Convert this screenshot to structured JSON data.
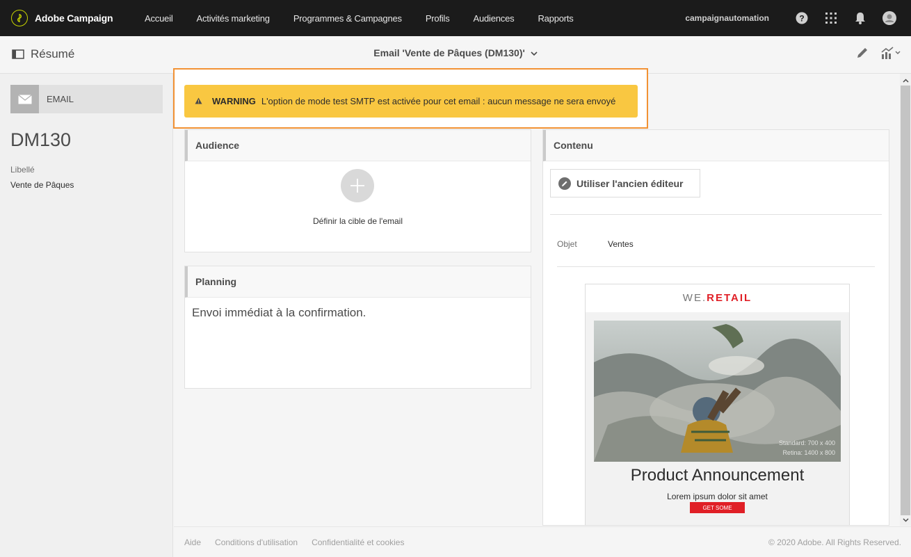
{
  "app": {
    "name": "Adobe Campaign",
    "user": "campaignautomation",
    "nav": [
      "Accueil",
      "Activités marketing",
      "Programmes & Campagnes",
      "Profils",
      "Audiences",
      "Rapports"
    ]
  },
  "subheader": {
    "summary_label": "Résumé",
    "title": "Email 'Vente de Pâques (DM130)'"
  },
  "left": {
    "channel_label": "EMAIL",
    "id": "DM130",
    "field_label": "Libellé",
    "field_value": "Vente de Pâques"
  },
  "warning": {
    "label": "WARNING",
    "message": "L'option de mode test SMTP est activée pour cet email : aucun message ne sera envoyé"
  },
  "audience": {
    "title": "Audience",
    "action": "Définir la cible de l'email"
  },
  "planning": {
    "title": "Planning",
    "text": "Envoi immédiat à la confirmation."
  },
  "contenu": {
    "title": "Contenu",
    "old_editor": "Utiliser l'ancien éditeur",
    "object_label": "Objet",
    "object_value": "Ventes",
    "preview": {
      "brand_a": "WE.",
      "brand_b": "RETAIL",
      "caption_1": "Standard: 700 x 400",
      "caption_2": "Retina: 1400 x 800",
      "title": "Product Announcement",
      "subtitle": "Lorem ipsum dolor sit amet",
      "button": "GET SOME"
    }
  },
  "footer": {
    "links": [
      "Aide",
      "Conditions d'utilisation",
      "Confidentialité et cookies"
    ],
    "copyright": "© 2020 Adobe. All Rights Reserved."
  },
  "colors": {
    "topbar": "#1b1b1b",
    "warning_bg": "#f9c741",
    "highlight_outline": "#f29234",
    "brand_red": "#e01f26"
  },
  "icons": [
    "adobe-campaign-logo-icon",
    "help-icon",
    "apps-grid-icon",
    "bell-icon",
    "user-avatar-icon",
    "summary-panel-icon",
    "chevron-down-icon",
    "pencil-icon",
    "chart-icon",
    "envelope-icon",
    "warning-icon",
    "plus-icon",
    "edit-icon"
  ]
}
